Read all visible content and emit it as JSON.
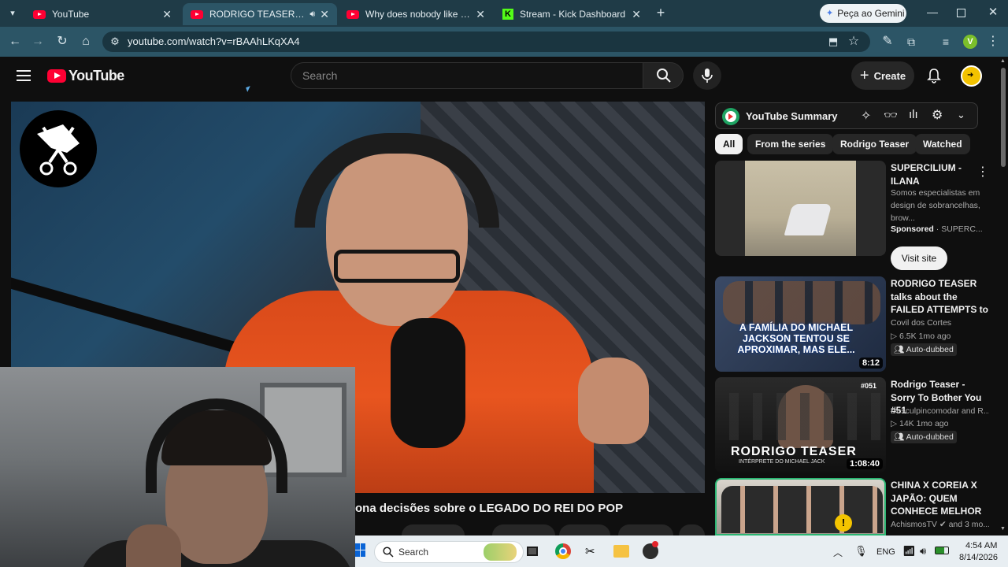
{
  "browser": {
    "tabs": [
      {
        "title": "YouTube",
        "favicon": "youtube-icon",
        "active": false
      },
      {
        "title": "RODRIGO TEASER (COVER",
        "favicon": "youtube-icon",
        "active": true,
        "audio": true
      },
      {
        "title": "Why does nobody like the Black",
        "favicon": "youtube-icon",
        "active": false
      },
      {
        "title": "Stream - Kick Dashboard",
        "favicon": "kick-icon",
        "active": false
      }
    ],
    "gemini_label": "Peça ao Gemini",
    "url": "youtube.com/watch?v=rBAAhLKqXA4",
    "profile_initial": "V"
  },
  "youtube": {
    "logo_text": "YouTube",
    "search_placeholder": "Search",
    "create_label": "Create"
  },
  "player": {
    "overlay_title": "ona decisões sobre o LEGADO DO REI DO POP"
  },
  "sidebar": {
    "summary_title": "YouTube Summary",
    "chips": [
      "All",
      "From the series",
      "Rodrigo Teaser",
      "Watched"
    ],
    "videos": [
      {
        "title": "SUPERCILIUM - ILANA",
        "description": "Somos especialistas em design de sobrancelhas, brow...",
        "sponsored": "Sponsored",
        "channel": "SUPERC...",
        "button": "Visit site"
      },
      {
        "title": "RODRIGO TEASER talks about the FAILED ATTEMPTS to REACH...",
        "channel": "Covil dos Cortes",
        "stats": "6.5K  1mo ago",
        "badge": "Auto-dubbed",
        "duration": "8:12",
        "thumb_text": "A FAMÍLIA DO MICHAEL JACKSON TENTOU SE APROXIMAR, MAS ELE..."
      },
      {
        "title": "Rodrigo Teaser - Sorry To Bother You #51",
        "channel": "Desculpincomodar and R...",
        "stats": "14K  1mo ago",
        "badge": "Auto-dubbed",
        "duration": "1:08:40",
        "thumb_text": "RODRIGO TEASER",
        "thumb_subtext": "INTÉRPRETE DO MICHAEL JACK",
        "thumb_tag": "#051"
      },
      {
        "title": "CHINA X COREIA X JAPÃO: QUEM CONHECE MELHOR A...",
        "channel": "AchismosTV",
        "channel_suffix": "and 3 mo..."
      }
    ]
  },
  "taskbar": {
    "search_label": "Search",
    "language": "ENG",
    "time": "4:54 AM",
    "date": "8/14/2026"
  },
  "colors": {
    "tab_bar": "#1f3b47",
    "toolbar": "#2c5566",
    "youtube_red": "#ff0033",
    "hoodie": "#e8551f"
  }
}
